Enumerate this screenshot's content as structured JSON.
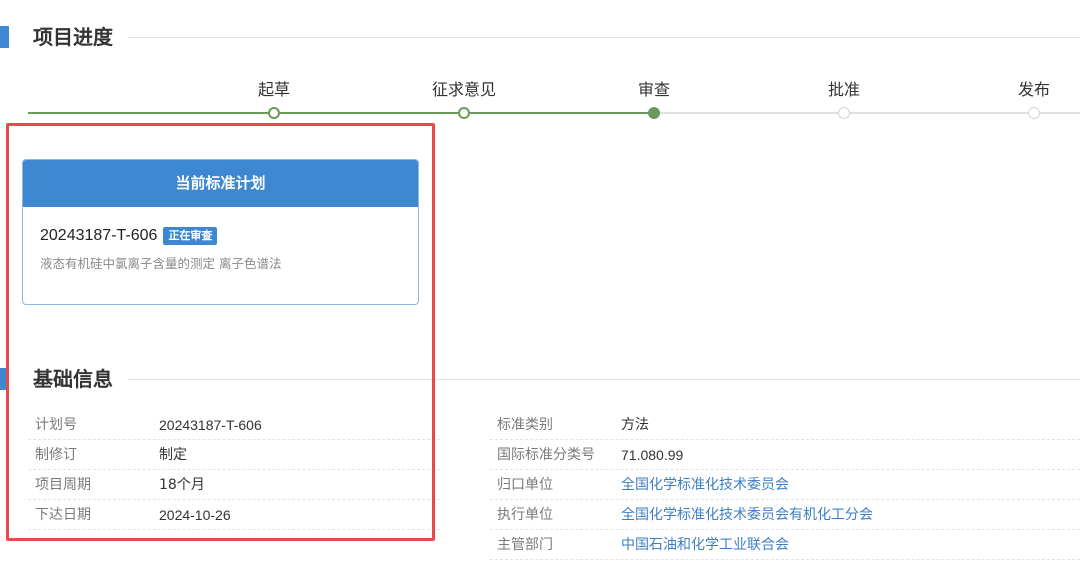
{
  "progress_section": {
    "title": "项目进度"
  },
  "progress": {
    "steps": [
      {
        "label": "起草",
        "state": "done"
      },
      {
        "label": "征求意见",
        "state": "done"
      },
      {
        "label": "审查",
        "state": "current"
      },
      {
        "label": "批准",
        "state": "future"
      },
      {
        "label": "发布",
        "state": "future"
      }
    ],
    "colors": {
      "done": "#6a9a5a",
      "future": "#d6d6d6"
    }
  },
  "current_plan": {
    "header": "当前标准计划",
    "plan_no": "20243187-T-606",
    "badge": "正在审查",
    "name": "液态有机硅中氯离子含量的测定 离子色谱法"
  },
  "basic_section": {
    "title": "基础信息"
  },
  "basic_info": {
    "left": [
      {
        "label": "计划号",
        "value": "20243187-T-606"
      },
      {
        "label": "制修订",
        "value": "制定"
      },
      {
        "label": "项目周期",
        "value": "18个月"
      },
      {
        "label": "下达日期",
        "value": "2024-10-26"
      }
    ],
    "right": [
      {
        "label": "标准类别",
        "value": "方法"
      },
      {
        "label": "国际标准分类号",
        "value": "71.080.99"
      },
      {
        "label": "归口单位",
        "value": "全国化学标准化技术委员会"
      },
      {
        "label": "执行单位",
        "value": "全国化学标准化技术委员会有机化工分会"
      },
      {
        "label": "主管部门",
        "value": "中国石油和化学工业联合会"
      }
    ]
  },
  "colors": {
    "accent": "#3e88d2",
    "link": "#3e7fc4",
    "highlight": "#e64a4a"
  }
}
